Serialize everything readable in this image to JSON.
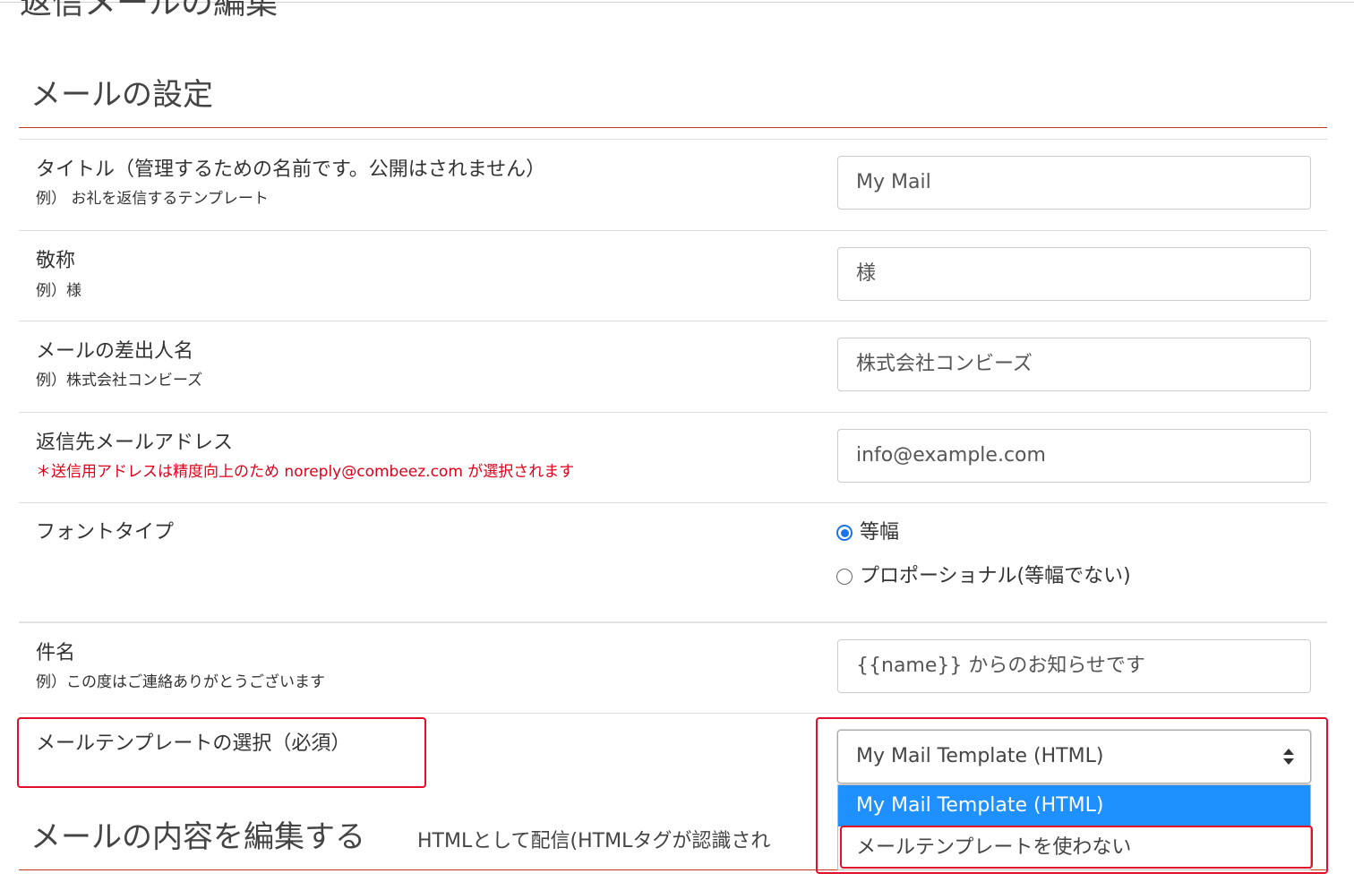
{
  "page": {
    "title": "返信メールの編集"
  },
  "mail_settings": {
    "section_title": "メールの設定",
    "title_field": {
      "label": "タイトル（管理するための名前です。公開はされません）",
      "example": "例） お礼を返信するテンプレート",
      "value": "My Mail"
    },
    "honorific_field": {
      "label": "敬称",
      "example": "例）様",
      "value": "様"
    },
    "sender_field": {
      "label": "メールの差出人名",
      "example": "例）株式会社コンビーズ",
      "value": "株式会社コンビーズ"
    },
    "reply_to_field": {
      "label": "返信先メールアドレス",
      "note": "＊送信用アドレスは精度向上のため noreply@combeez.com が選択されます",
      "value": "info@example.com"
    },
    "font_type": {
      "label": "フォントタイプ",
      "options": [
        "等幅",
        "プロポーショナル(等幅でない)"
      ],
      "selected_index": 0
    },
    "subject_field": {
      "label": "件名",
      "example": "例）この度はご連絡ありがとうございます",
      "value": "{{name}} からのお知らせです"
    },
    "template_select": {
      "label": "メールテンプレートの選択（必須）",
      "selected": "My Mail Template (HTML)",
      "options": [
        "My Mail Template (HTML)",
        "メールテンプレートを使わない"
      ]
    }
  },
  "content": {
    "section_title": "メールの内容を編集する",
    "format_note": "HTMLとして配信(HTMLタグが認識され"
  },
  "colors": {
    "accent_line": "#c0392b",
    "highlight_box": "#e0102a",
    "dropdown_selected": "#1e90ff",
    "radio_checked": "#1a73e8",
    "note_red": "#e0001a"
  }
}
